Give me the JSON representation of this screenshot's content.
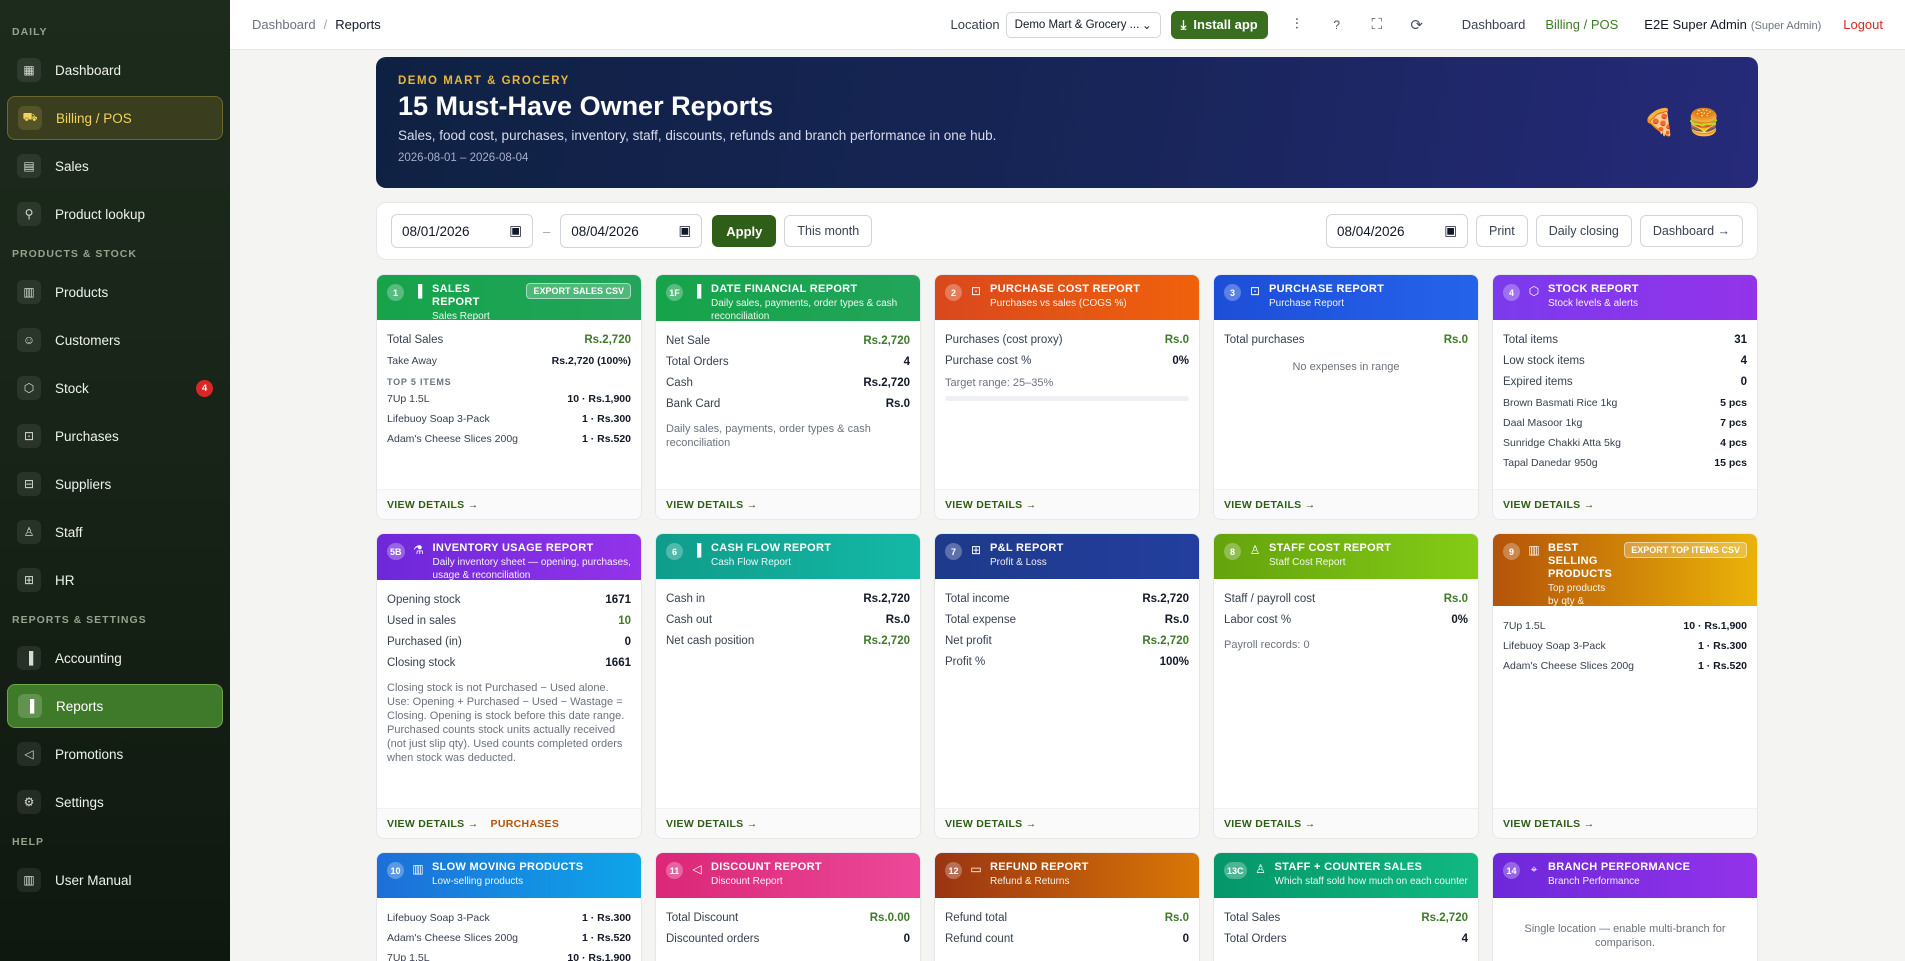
{
  "sidebar": {
    "sections": [
      "DAILY",
      "PRODUCTS & STOCK",
      "REPORTS & SETTINGS",
      "HELP"
    ],
    "items": [
      {
        "label": "Dashboard",
        "icon": "dashboard-icon"
      },
      {
        "label": "Billing / POS",
        "icon": "cart-icon"
      },
      {
        "label": "Sales",
        "icon": "clipboard-icon"
      },
      {
        "label": "Product lookup",
        "icon": "search-icon"
      },
      {
        "label": "Products",
        "icon": "book-icon"
      },
      {
        "label": "Customers",
        "icon": "users-icon"
      },
      {
        "label": "Stock",
        "icon": "box-icon",
        "badge": "4"
      },
      {
        "label": "Purchases",
        "icon": "lock-icon"
      },
      {
        "label": "Suppliers",
        "icon": "truck-icon"
      },
      {
        "label": "Staff",
        "icon": "person-icon"
      },
      {
        "label": "HR",
        "icon": "briefcase-icon"
      },
      {
        "label": "Accounting",
        "icon": "bar-chart-icon"
      },
      {
        "label": "Reports",
        "icon": "bar-chart-icon"
      },
      {
        "label": "Promotions",
        "icon": "megaphone-icon"
      },
      {
        "label": "Settings",
        "icon": "gear-icon"
      },
      {
        "label": "User Manual",
        "icon": "book-icon"
      }
    ]
  },
  "topbar": {
    "breadcrumb": [
      "Dashboard",
      "Reports"
    ],
    "location_label": "Location",
    "location_value": "Demo Mart & Grocery ...",
    "install_label": "Install app",
    "help": "?",
    "links": [
      "Dashboard",
      "Billing / POS"
    ],
    "user_name": "E2E Super Admin",
    "user_role": "(Super Admin)",
    "logout": "Logout"
  },
  "hero": {
    "brand": "DEMO MART & GROCERY",
    "title": "15 Must-Have Owner Reports",
    "subtitle": "Sales, food cost, purchases, inventory, staff, discounts, refunds and branch performance in one hub.",
    "dates": "2026-08-01 – 2026-08-04"
  },
  "filters": {
    "from": "08/01/2026",
    "to": "08/04/2026",
    "dash": "–",
    "apply": "Apply",
    "this_month": "This month",
    "day": "08/04/2026",
    "print": "Print",
    "daily_closing": "Daily closing",
    "dashboard": "Dashboard →"
  },
  "view_details": "VIEW DETAILS →",
  "cards": {
    "sales": {
      "num": "1",
      "title": "SALES REPORT",
      "sub": "Sales Report",
      "export": "EXPORT SALES CSV",
      "total_label": "Total Sales",
      "total_value": "Rs.2,720",
      "takeaway_label": "Take Away",
      "takeaway_value": "Rs.2,720 (100%)",
      "top_label": "TOP 5 ITEMS",
      "items": [
        {
          "n": "7Up 1.5L",
          "v": "10 · Rs.1,900"
        },
        {
          "n": "Lifebuoy Soap 3-Pack",
          "v": "1 · Rs.300"
        },
        {
          "n": "Adam's Cheese Slices 200g",
          "v": "1 · Rs.520"
        }
      ]
    },
    "financial": {
      "num": "1F",
      "title": "DATE FINANCIAL REPORT",
      "sub": "Daily sales, payments, order types & cash reconciliation",
      "rows": [
        {
          "l": "Net Sale",
          "v": "Rs.2,720"
        },
        {
          "l": "Total Orders",
          "v": "4"
        },
        {
          "l": "Cash",
          "v": "Rs.2,720"
        },
        {
          "l": "Bank Card",
          "v": "Rs.0"
        }
      ],
      "note": "Daily sales, payments, order types & cash reconciliation"
    },
    "purchase_cost": {
      "num": "2",
      "title": "PURCHASE COST REPORT",
      "sub": "Purchases vs sales (COGS %)",
      "rows": [
        {
          "l": "Purchases (cost proxy)",
          "v": "Rs.0"
        },
        {
          "l": "Purchase cost %",
          "v": "0%"
        }
      ],
      "target": "Target range: 25–35%"
    },
    "purchase": {
      "num": "3",
      "title": "PURCHASE REPORT",
      "sub": "Purchase Report",
      "total_label": "Total purchases",
      "total_value": "Rs.0",
      "empty": "No expenses in range"
    },
    "stock": {
      "num": "4",
      "title": "STOCK REPORT",
      "sub": "Stock levels & alerts",
      "rows": [
        {
          "l": "Total items",
          "v": "31"
        },
        {
          "l": "Low stock items",
          "v": "4"
        },
        {
          "l": "Expired items",
          "v": "0"
        }
      ],
      "items": [
        {
          "n": "Brown Basmati Rice 1kg",
          "v": "5 pcs"
        },
        {
          "n": "Daal Masoor 1kg",
          "v": "7 pcs"
        },
        {
          "n": "Sunridge Chakki Atta 5kg",
          "v": "4 pcs"
        },
        {
          "n": "Tapal Danedar 950g",
          "v": "15 pcs"
        }
      ]
    },
    "inventory": {
      "num": "5B",
      "title": "INVENTORY USAGE REPORT",
      "sub": "Daily inventory sheet — opening, purchases, usage & reconciliation",
      "rows": [
        {
          "l": "Opening stock",
          "v": "1671"
        },
        {
          "l": "Used in sales",
          "v": "10"
        },
        {
          "l": "Purchased (in)",
          "v": "0"
        },
        {
          "l": "Closing stock",
          "v": "1661"
        }
      ],
      "note": "Closing stock is not Purchased − Used alone. Use: Opening + Purchased − Used − Wastage = Closing. Opening is stock before this date range. Purchased counts stock units actually received (not just slip qty). Used counts completed orders when stock was deducted.",
      "purchases_link": "PURCHASES"
    },
    "cashflow": {
      "num": "6",
      "title": "CASH FLOW REPORT",
      "sub": "Cash Flow Report",
      "rows": [
        {
          "l": "Cash in",
          "v": "Rs.2,720"
        },
        {
          "l": "Cash out",
          "v": "Rs.0"
        },
        {
          "l": "Net cash position",
          "v": "Rs.2,720"
        }
      ]
    },
    "pl": {
      "num": "7",
      "title": "P&L REPORT",
      "sub": "Profit & Loss",
      "rows": [
        {
          "l": "Total income",
          "v": "Rs.2,720"
        },
        {
          "l": "Total expense",
          "v": "Rs.0"
        },
        {
          "l": "Net profit",
          "v": "Rs.2,720"
        },
        {
          "l": "Profit %",
          "v": "100%"
        }
      ]
    },
    "staff_cost": {
      "num": "8",
      "title": "STAFF COST REPORT",
      "sub": "Staff Cost Report",
      "rows": [
        {
          "l": "Staff / payroll cost",
          "v": "Rs.0"
        },
        {
          "l": "Labor cost %",
          "v": "0%"
        }
      ],
      "note": "Payroll records: 0"
    },
    "best": {
      "num": "9",
      "title": "BEST SELLING PRODUCTS",
      "sub": "Top products by qty & revenue",
      "export": "EXPORT TOP ITEMS CSV",
      "items": [
        {
          "n": "7Up 1.5L",
          "v": "10 · Rs.1,900"
        },
        {
          "n": "Lifebuoy Soap 3-Pack",
          "v": "1 · Rs.300"
        },
        {
          "n": "Adam's Cheese Slices 200g",
          "v": "1 · Rs.520"
        }
      ]
    },
    "slow": {
      "num": "10",
      "title": "SLOW MOVING PRODUCTS",
      "sub": "Low-selling products",
      "items": [
        {
          "n": "Lifebuoy Soap 3-Pack",
          "v": "1 · Rs.300"
        },
        {
          "n": "Adam's Cheese Slices 200g",
          "v": "1 · Rs.520"
        },
        {
          "n": "7Up 1.5L",
          "v": "10 · Rs.1,900"
        }
      ]
    },
    "discount": {
      "num": "11",
      "title": "DISCOUNT REPORT",
      "sub": "Discount Report",
      "rows": [
        {
          "l": "Total Discount",
          "v": "Rs.0.00"
        },
        {
          "l": "Discounted orders",
          "v": "0"
        }
      ]
    },
    "refund": {
      "num": "12",
      "title": "REFUND REPORT",
      "sub": "Refund & Returns",
      "rows": [
        {
          "l": "Refund total",
          "v": "Rs.0"
        },
        {
          "l": "Refund count",
          "v": "0"
        }
      ]
    },
    "staff_sales": {
      "num": "13C",
      "title": "STAFF + COUNTER SALES",
      "sub": "Which staff sold how much on each counter",
      "rows": [
        {
          "l": "Total Sales",
          "v": "Rs.2,720"
        },
        {
          "l": "Total Orders",
          "v": "4"
        }
      ]
    },
    "branch": {
      "num": "14",
      "title": "BRANCH PERFORMANCE",
      "sub": "Branch Performance",
      "note": "Single location — enable multi-branch for comparison."
    }
  }
}
